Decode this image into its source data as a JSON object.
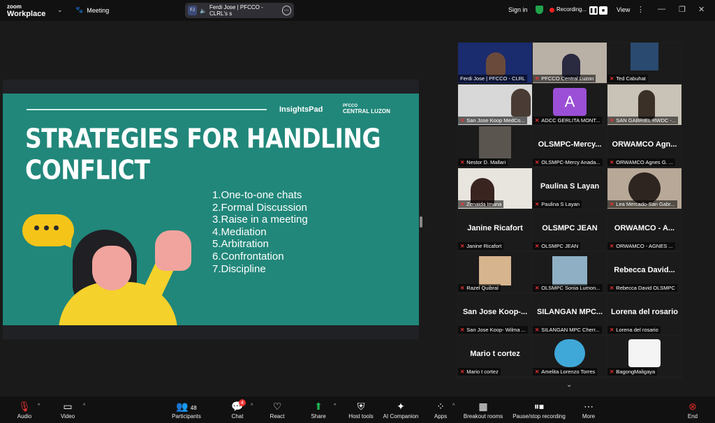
{
  "topbar": {
    "logo_small": "zoom",
    "logo_big": "Workplace",
    "meeting_label": "Meeting",
    "speaker_initials": "FJ",
    "speaker_text": "Ferdi Jose | PFCCO - CLRL's s",
    "sign_in": "Sign in",
    "recording": "Recording...",
    "view": "View"
  },
  "slide": {
    "brand_insights": "InsightsPad",
    "brand_pfcco_top": "PFCCO",
    "brand_pfcco_bottom": "CENTRAL LUZON",
    "title": "STRATEGIES FOR HANDLING CONFLICT",
    "items": [
      "1.One-to-one chats",
      "2.Formal Discussion",
      "3.Raise in a meeting",
      "4.Mediation",
      "5.Arbitration",
      "6.Confrontation",
      "7.Discipline"
    ]
  },
  "gallery": {
    "tiles": [
      {
        "name": "Ferdi Jose | PFCCO - CLRL",
        "big": "",
        "active": true,
        "muted": false
      },
      {
        "name": "PFCCO Central Luzon",
        "big": "",
        "muted": true
      },
      {
        "name": "Ted Cabuhat",
        "big": "",
        "muted": true
      },
      {
        "name": "San Jose Koop MedCo...",
        "big": "",
        "muted": true
      },
      {
        "name": "ADCC GERLITA MONT...",
        "big": "",
        "muted": true
      },
      {
        "name": "SAN GABRIEL RWDC -...",
        "big": "",
        "muted": true
      },
      {
        "name": "Nestor D. Mallari",
        "big": "",
        "muted": true
      },
      {
        "name": "OLSMPC-Mercy Anada...",
        "big": "OLSMPC-Mercy...",
        "muted": true
      },
      {
        "name": "ORWAMCO Agnes G. ...",
        "big": "ORWAMCO  Agn...",
        "muted": true
      },
      {
        "name": "Zenaida Imana",
        "big": "",
        "muted": true
      },
      {
        "name": "Paulina S Layan",
        "big": "Paulina S Layan",
        "muted": true
      },
      {
        "name": "Lea Mercado-San Gabr...",
        "big": "",
        "muted": true
      },
      {
        "name": "Janine Ricafort",
        "big": "Janine Ricafort",
        "muted": true
      },
      {
        "name": "OLSMPC JEAN",
        "big": "OLSMPC JEAN",
        "muted": true
      },
      {
        "name": "ORWAMCO - AGNES ...",
        "big": "ORWAMCO  -  A...",
        "muted": true
      },
      {
        "name": "Razel Quibral",
        "big": "",
        "muted": true
      },
      {
        "name": "OLSMPC Sonia Lumon...",
        "big": "",
        "muted": true
      },
      {
        "name": "Rebecca David OLSMPC",
        "big": "Rebecca  David...",
        "muted": true
      },
      {
        "name": "San Jose Koop- Wilma ...",
        "big": "San Jose Koop-...",
        "muted": true
      },
      {
        "name": "SILANGAN MPC Cherr...",
        "big": "SILANGAN  MPC...",
        "muted": true
      },
      {
        "name": "Lorena del rosario",
        "big": "Lorena del rosario",
        "muted": true
      },
      {
        "name": "Mario t cortez",
        "big": "Mario t cortez",
        "muted": true
      },
      {
        "name": "Amelita Lorenzo Torres",
        "big": "",
        "muted": true
      },
      {
        "name": "BagongMaligaya",
        "big": "",
        "muted": true
      }
    ],
    "avatar_letter": "A"
  },
  "toolbar": {
    "audio": "Audio",
    "video": "Video",
    "participants": "Participants",
    "participants_count": "48",
    "chat": "Chat",
    "chat_badge": "4",
    "react": "React",
    "share": "Share",
    "host_tools": "Host tools",
    "ai_companion": "AI Companion",
    "apps": "Apps",
    "breakout": "Breakout rooms",
    "pause_rec": "Pause/stop recording",
    "more": "More",
    "end": "End"
  },
  "colors": {
    "slide_bg": "#21877a",
    "accent_yellow": "#f4c419",
    "active_border": "#2fd3a0",
    "share_green": "#1fb854",
    "end_red": "#e02828"
  },
  "icons": [
    "mic-muted-icon",
    "video-icon",
    "participants-icon",
    "chat-icon",
    "react-icon",
    "share-icon",
    "host-tools-icon",
    "ai-companion-icon",
    "apps-icon",
    "breakout-icon",
    "pause-record-icon",
    "more-icon",
    "end-icon",
    "shield-icon",
    "paw-icon"
  ]
}
